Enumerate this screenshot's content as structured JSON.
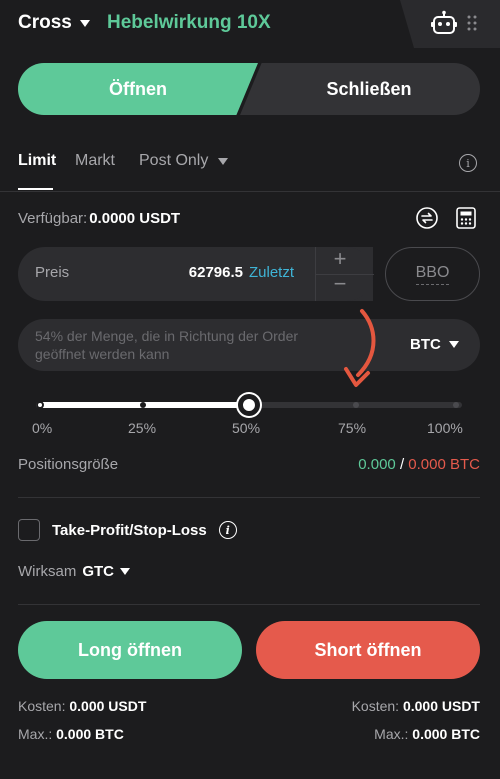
{
  "header": {
    "margin_mode": "Cross",
    "leverage": "Hebelwirkung 10X",
    "icons": [
      "robot-icon",
      "drag-grip-icon"
    ]
  },
  "segment": {
    "open_label": "Öffnen",
    "close_label": "Schließen",
    "active": "open",
    "open_color": "#5ec999"
  },
  "tabs": {
    "items": [
      "Limit",
      "Markt",
      "Post Only"
    ],
    "active": "Limit"
  },
  "balance": {
    "label": "Verfügbar:",
    "value": "0.0000 USDT"
  },
  "price": {
    "label": "Preis",
    "value": "62796.5",
    "last_label": "Zuletzt",
    "plus": "+",
    "minus": "−",
    "bbo_label": "BBO"
  },
  "quantity": {
    "placeholder": "54% der Menge, die in Richtung der Order geöffnet werden kann",
    "unit": "BTC"
  },
  "slider": {
    "value_percent": 50,
    "labels": [
      "0%",
      "25%",
      "50%",
      "75%",
      "100%"
    ]
  },
  "position_size": {
    "label": "Positionsgröße",
    "long_value": "0.000",
    "separator": "/",
    "short_value": "0.000 BTC"
  },
  "tpsl": {
    "label": "Take-Profit/Stop-Loss",
    "checked": false
  },
  "time_in_force": {
    "label": "Wirksam",
    "value": "GTC"
  },
  "buttons": {
    "long": "Long öffnen",
    "short": "Short öffnen",
    "long_color": "#5ec999",
    "short_color": "#e55a4c"
  },
  "costs": {
    "long_cost_label": "Kosten:",
    "long_cost_value": "0.000 USDT",
    "short_cost_label": "Kosten:",
    "short_cost_value": "0.000 USDT",
    "long_max_label": "Max.:",
    "long_max_value": "0.000 BTC",
    "short_max_label": "Max.:",
    "short_max_value": "0.000 BTC"
  }
}
